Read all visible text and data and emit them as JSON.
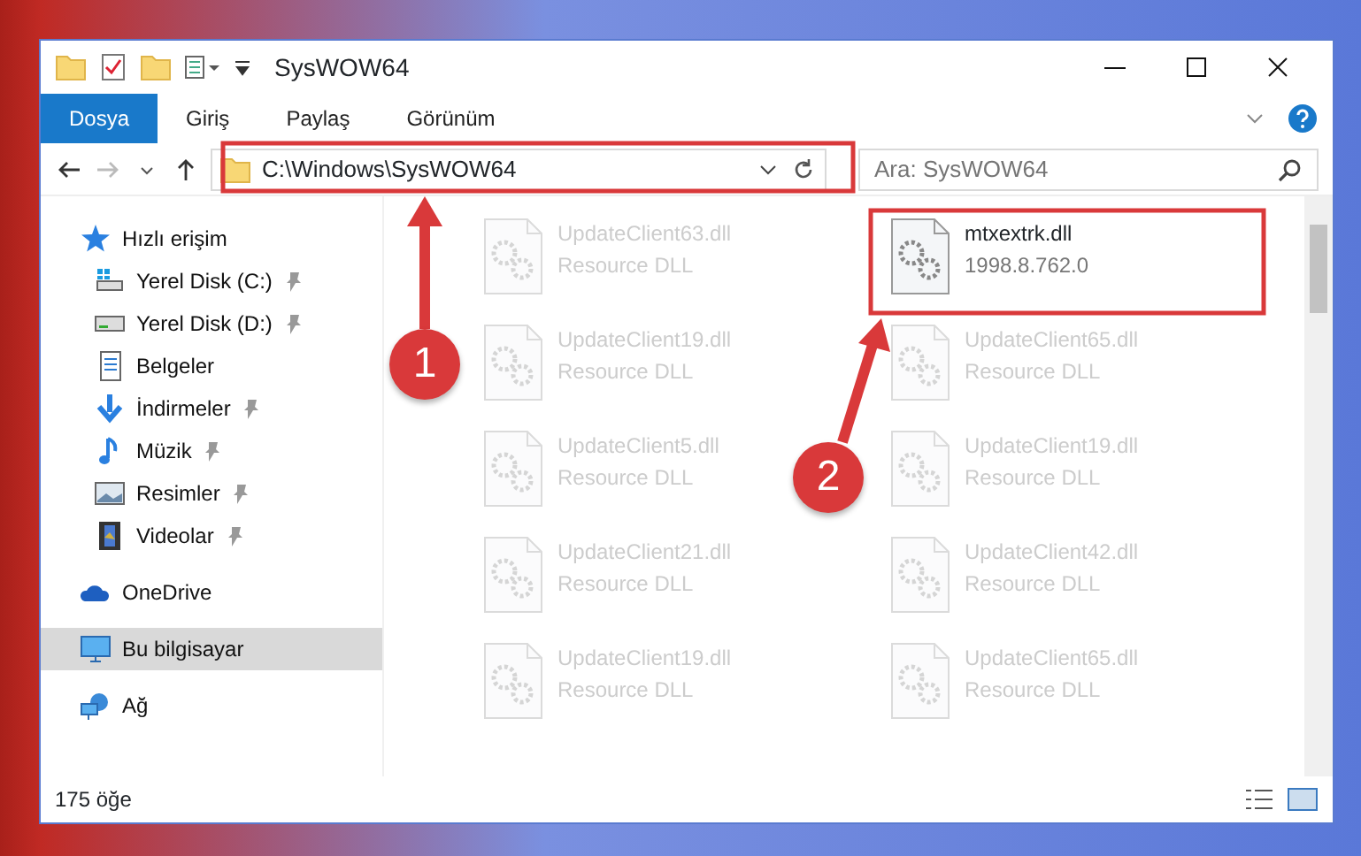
{
  "window": {
    "title": "SysWOW64"
  },
  "ribbon_tabs": [
    {
      "label": "Dosya",
      "selected": true
    },
    {
      "label": "Giriş",
      "selected": false
    },
    {
      "label": "Paylaş",
      "selected": false
    },
    {
      "label": "Görünüm",
      "selected": false
    }
  ],
  "address_bar": {
    "path": "C:\\Windows\\SysWOW64"
  },
  "search": {
    "placeholder": "Ara: SysWOW64"
  },
  "sidebar": {
    "items": [
      {
        "label": "Hızlı erişim",
        "selected": false,
        "pinned": false,
        "children": [
          {
            "label": "Yerel Disk (C:)",
            "selected": false,
            "pinned": true
          },
          {
            "label": "Yerel Disk (D:)",
            "selected": false,
            "pinned": true
          },
          {
            "label": "Belgeler",
            "selected": false,
            "pinned": false
          },
          {
            "label": "İndirmeler",
            "selected": false,
            "pinned": true
          },
          {
            "label": "Müzik",
            "selected": false,
            "pinned": true
          },
          {
            "label": "Resimler",
            "selected": false,
            "pinned": true
          },
          {
            "label": "Videolar",
            "selected": false,
            "pinned": true
          }
        ]
      },
      {
        "label": "OneDrive",
        "selected": false,
        "pinned": false
      },
      {
        "label": "Bu bilgisayar",
        "selected": true,
        "pinned": false
      },
      {
        "label": "Ağ",
        "selected": false,
        "pinned": false
      }
    ]
  },
  "files": [
    {
      "name": "UpdateClient63.dll",
      "detail": "Resource DLL",
      "kind": "blurred"
    },
    {
      "name": "mtxextrk.dll",
      "detail": "1998.8.762.0",
      "kind": "focus"
    },
    {
      "name": "UpdateClient19.dll",
      "detail": "Resource DLL",
      "kind": "blurred"
    },
    {
      "name": "UpdateClient65.dll",
      "detail": "Resource DLL",
      "kind": "blurred"
    },
    {
      "name": "UpdateClient5.dll",
      "detail": "Resource DLL",
      "kind": "blurred"
    },
    {
      "name": "UpdateClient19.dll",
      "detail": "Resource DLL",
      "kind": "blurred"
    },
    {
      "name": "UpdateClient21.dll",
      "detail": "Resource DLL",
      "kind": "blurred"
    },
    {
      "name": "UpdateClient42.dll",
      "detail": "Resource DLL",
      "kind": "blurred"
    },
    {
      "name": "UpdateClient19.dll",
      "detail": "Resource DLL",
      "kind": "blurred"
    },
    {
      "name": "UpdateClient65.dll",
      "detail": "Resource DLL",
      "kind": "blurred"
    }
  ],
  "status_bar": {
    "count": "175 öğe"
  },
  "annotations": [
    {
      "label": "1"
    },
    {
      "label": "2"
    }
  ]
}
